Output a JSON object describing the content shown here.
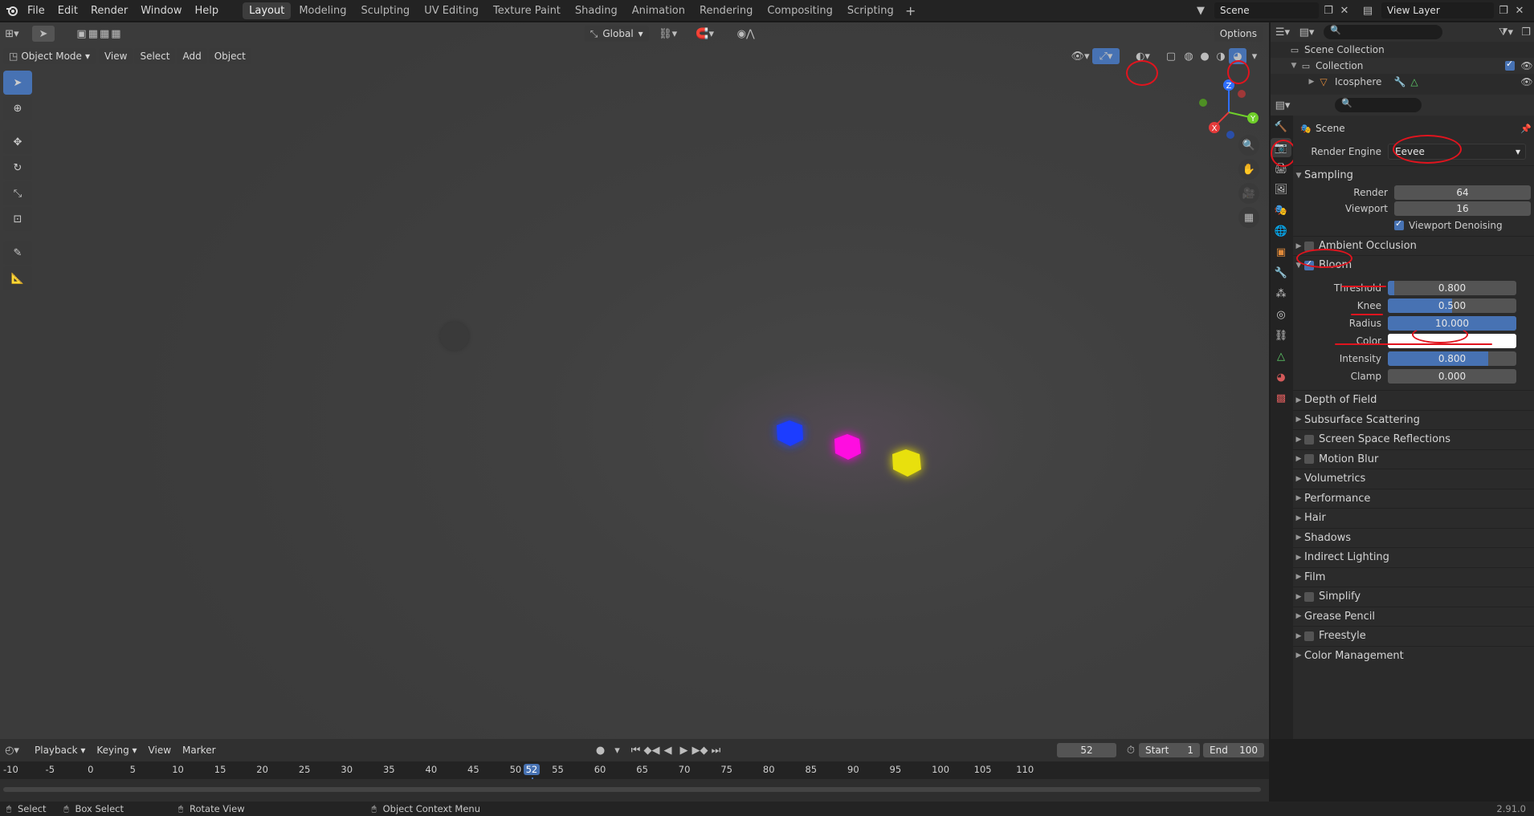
{
  "menu": {
    "file": "File",
    "edit": "Edit",
    "render": "Render",
    "window": "Window",
    "help": "Help"
  },
  "workspaces": [
    "Layout",
    "Modeling",
    "Sculpting",
    "UV Editing",
    "Texture Paint",
    "Shading",
    "Animation",
    "Rendering",
    "Compositing",
    "Scripting"
  ],
  "scene_name": "Scene",
  "view_layer": "View Layer",
  "viewport": {
    "mode": "Object Mode",
    "menus": {
      "view": "View",
      "select": "Select",
      "add": "Add",
      "object": "Object"
    },
    "transform_orientation": "Global",
    "options": "Options",
    "gizmo_axes": {
      "z": "Z",
      "y": "Y",
      "x": "X"
    }
  },
  "outliner": {
    "scene_collection": "Scene Collection",
    "collection": "Collection",
    "object": "Icosphere"
  },
  "properties": {
    "context": "Scene",
    "render_engine_label": "Render Engine",
    "render_engine": "Eevee",
    "sampling": {
      "title": "Sampling",
      "render_label": "Render",
      "render": "64",
      "viewport_label": "Viewport",
      "viewport": "16",
      "denoise": "Viewport Denoising"
    },
    "ambient_occlusion": "Ambient Occlusion",
    "bloom": {
      "title": "Bloom",
      "threshold_label": "Threshold",
      "threshold": "0.800",
      "threshold_fraction": 0.05,
      "knee_label": "Knee",
      "knee": "0.500",
      "knee_fraction": 0.5,
      "radius_label": "Radius",
      "radius": "10.000",
      "radius_fraction": 1.0,
      "color_label": "Color",
      "color": "#ffffff",
      "intensity_label": "Intensity",
      "intensity": "0.800",
      "intensity_fraction": 0.78,
      "clamp_label": "Clamp",
      "clamp": "0.000",
      "clamp_fraction": 0.0
    },
    "panels": [
      {
        "label": "Depth of Field",
        "checkbox": false
      },
      {
        "label": "Subsurface Scattering",
        "checkbox": false
      },
      {
        "label": "Screen Space Reflections",
        "checkbox": true
      },
      {
        "label": "Motion Blur",
        "checkbox": true
      },
      {
        "label": "Volumetrics",
        "checkbox": false
      },
      {
        "label": "Performance",
        "checkbox": false
      },
      {
        "label": "Hair",
        "checkbox": false
      },
      {
        "label": "Shadows",
        "checkbox": false
      },
      {
        "label": "Indirect Lighting",
        "checkbox": false
      },
      {
        "label": "Film",
        "checkbox": false
      },
      {
        "label": "Simplify",
        "checkbox": true
      },
      {
        "label": "Grease Pencil",
        "checkbox": false
      },
      {
        "label": "Freestyle",
        "checkbox": true
      },
      {
        "label": "Color Management",
        "checkbox": false
      }
    ]
  },
  "timeline": {
    "menus": {
      "playback": "Playback",
      "keying": "Keying",
      "view": "View",
      "marker": "Marker"
    },
    "current_frame": "52",
    "start_label": "Start",
    "start": "1",
    "end_label": "End",
    "end": "100",
    "ticks": [
      "-10",
      "-5",
      "0",
      "5",
      "10",
      "15",
      "20",
      "25",
      "30",
      "35",
      "40",
      "45",
      "50",
      "52",
      "55",
      "60",
      "65",
      "70",
      "75",
      "80",
      "85",
      "90",
      "95",
      "100",
      "105",
      "110"
    ]
  },
  "statusbar": {
    "select": "Select",
    "box_select": "Box Select",
    "rotate_view": "Rotate View",
    "context_menu": "Object Context Menu",
    "version": "2.91.0"
  },
  "colors": {
    "blue_hex": "#1a3cff",
    "magenta_hex": "#ff10e0",
    "yellow_hex": "#e8e010",
    "accent": "#4772b3",
    "annotation": "#e0141e"
  }
}
